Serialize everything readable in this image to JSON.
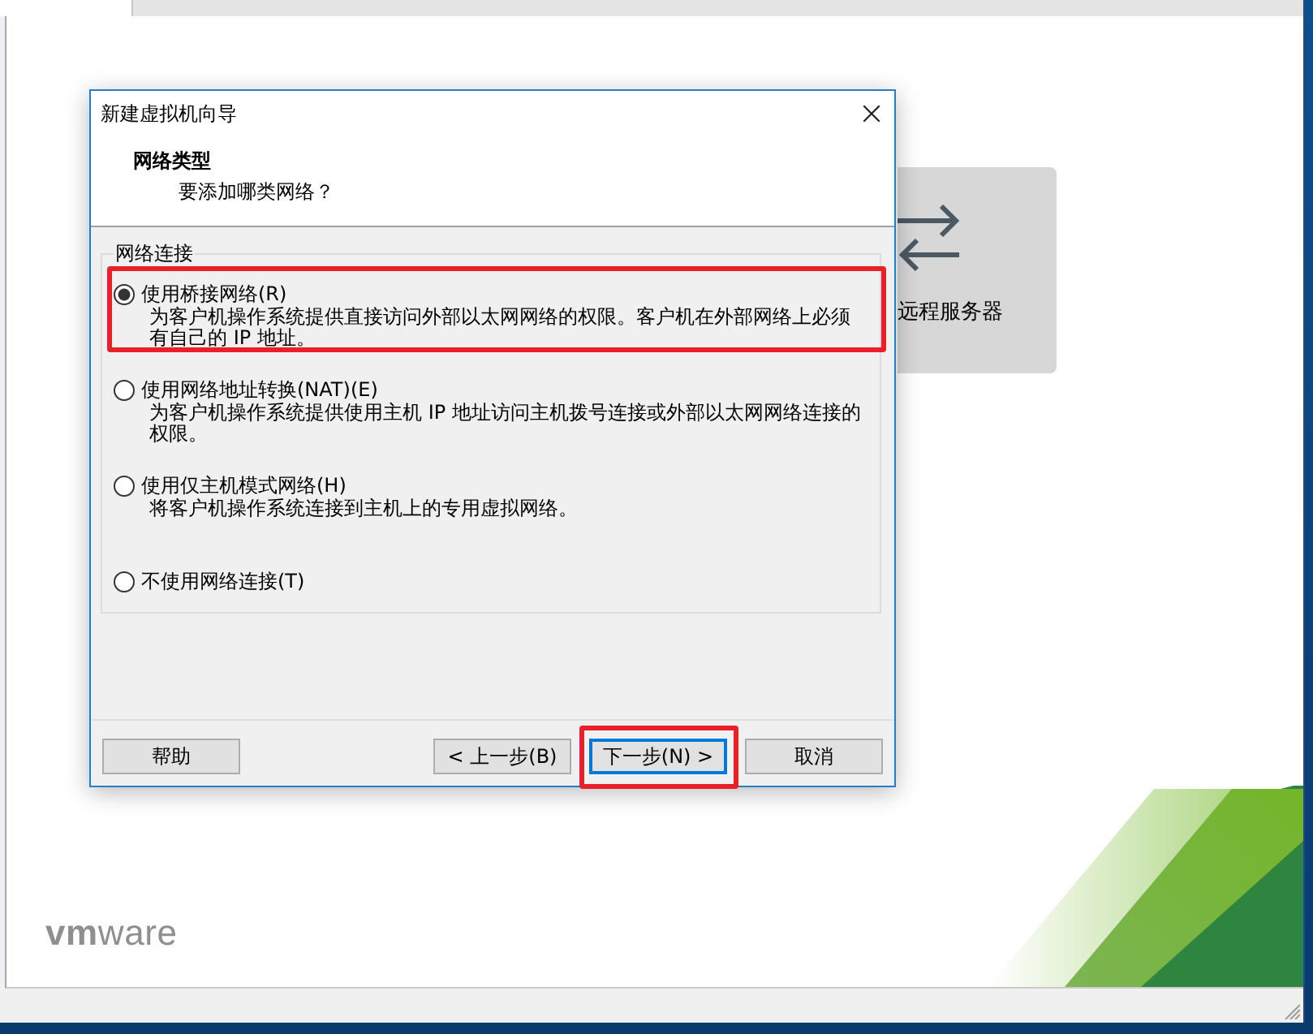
{
  "home": {
    "card": {
      "label": "远程服务器"
    },
    "logo": "**vm**ware"
  },
  "dialog": {
    "title": "新建虚拟机向导",
    "heading": "网络类型",
    "subheading": "要添加哪类网络？",
    "group_label": "网络连接",
    "options": [
      {
        "label": "使用桥接网络(R)",
        "description": "为客户机操作系统提供直接访问外部以太网网络的权限。客户机在外部网络上必须有自己的 IP 地址。",
        "selected": true,
        "highlighted": true
      },
      {
        "label": "使用网络地址转换(NAT)(E)",
        "description": "为客户机操作系统提供使用主机 IP 地址访问主机拨号连接或外部以太网网络连接的权限。",
        "selected": false,
        "highlighted": false
      },
      {
        "label": "使用仅主机模式网络(H)",
        "description": "将客户机操作系统连接到主机上的专用虚拟网络。",
        "selected": false,
        "highlighted": false
      },
      {
        "label": "不使用网络连接(T)",
        "selected": false,
        "highlighted": false
      }
    ],
    "buttons": [
      {
        "label": "帮助",
        "focused": false,
        "highlighted": false
      },
      {
        "label": "< 上一步(B)",
        "focused": false,
        "highlighted": false
      },
      {
        "label": "下一步(N) >",
        "focused": true,
        "highlighted": true
      },
      {
        "label": "取消",
        "focused": false,
        "highlighted": false
      }
    ]
  }
}
